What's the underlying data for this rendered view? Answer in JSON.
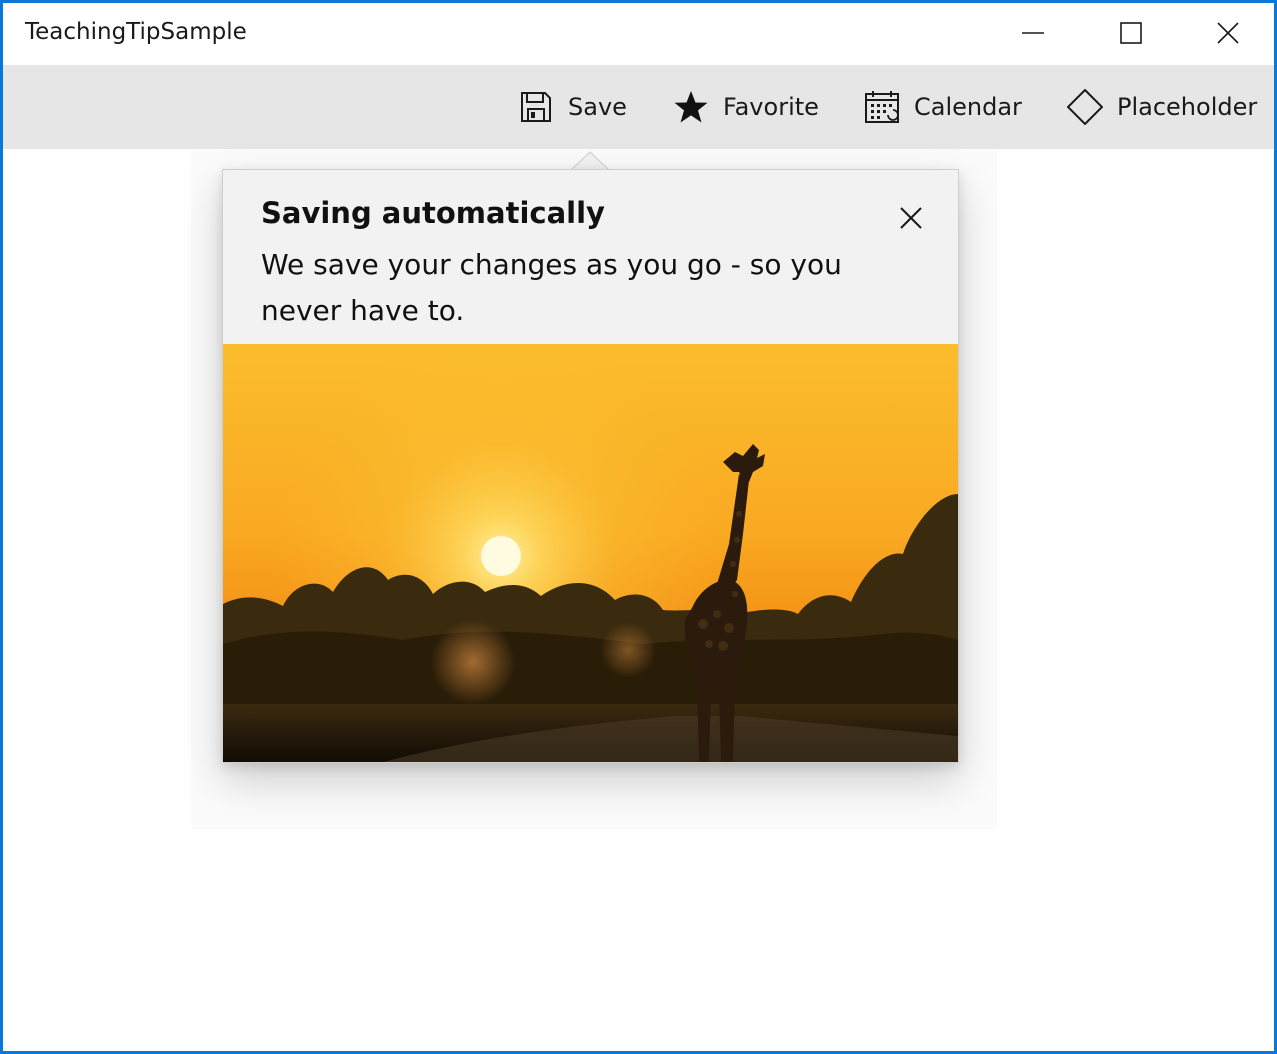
{
  "window": {
    "title": "TeachingTipSample"
  },
  "caption_buttons": {
    "minimize_icon": "minimize-icon",
    "maximize_icon": "maximize-icon",
    "close_icon": "close-icon"
  },
  "commandbar": {
    "items": [
      {
        "label": "Save",
        "icon": "save-icon"
      },
      {
        "label": "Favorite",
        "icon": "star-icon"
      },
      {
        "label": "Calendar",
        "icon": "calendar-icon"
      },
      {
        "label": "Placeholder",
        "icon": "placeholder-diamond-icon"
      }
    ]
  },
  "teaching_tip": {
    "title": "Saving automatically",
    "subtitle": "We save your changes as you go - so you never have to.",
    "close_icon": "close-icon",
    "hero_image": "giraffe-sunset-image"
  },
  "colors": {
    "accent_border": "#0a78d7",
    "commandbar_bg": "#e6e6e6",
    "tip_bg": "#f2f2f2",
    "text": "#1a1a1a"
  }
}
